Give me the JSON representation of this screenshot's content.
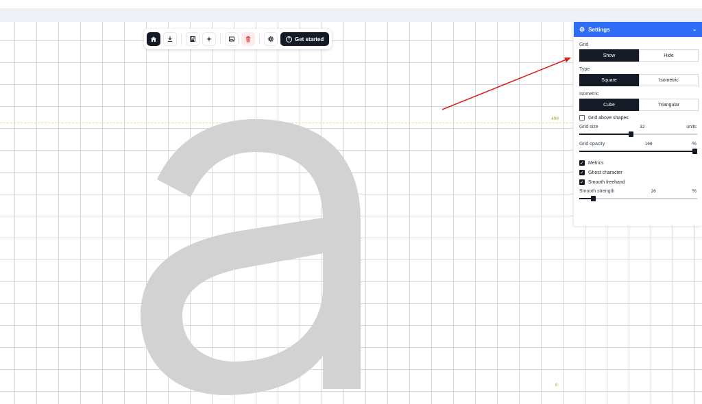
{
  "toolbar": {
    "buttons": [
      {
        "name": "home",
        "icon": "home-icon"
      },
      {
        "name": "download",
        "icon": "download-icon"
      },
      {
        "name": "save",
        "icon": "save-icon"
      },
      {
        "name": "sparkle",
        "icon": "sparkle-icon"
      },
      {
        "name": "image",
        "icon": "image-icon"
      },
      {
        "name": "delete",
        "icon": "trash-icon"
      },
      {
        "name": "settings",
        "icon": "gear-icon"
      }
    ],
    "get_started_label": "Get started",
    "accent": "#141a26",
    "danger": "#e53935"
  },
  "canvas": {
    "ghost_character": "a",
    "ascender_value": "490",
    "baseline_value": "0"
  },
  "settings": {
    "title": "Settings",
    "header_color": "#2f6df6",
    "grid": {
      "label": "Grid",
      "options": [
        "Show",
        "Hide"
      ],
      "selected": "Show"
    },
    "type": {
      "label": "Type",
      "options": [
        "Square",
        "Isometric"
      ],
      "selected": "Square"
    },
    "isometric": {
      "label": "Isometric",
      "options": [
        "Cube",
        "Triangular"
      ],
      "selected": "Cube"
    },
    "grid_above_shapes": {
      "label": "Grid above shapes",
      "checked": false
    },
    "grid_size": {
      "label": "Grid size",
      "value": "32",
      "unit": "units",
      "fraction": 0.44
    },
    "grid_opacity": {
      "label": "Grid opacity",
      "value": "100",
      "unit": "%",
      "fraction": 1.0
    },
    "metrics": {
      "label": "Metrics",
      "checked": true
    },
    "ghost_character": {
      "label": "Ghost character",
      "checked": true
    },
    "smooth_freehand": {
      "label": "Smooth freehand",
      "checked": true
    },
    "smooth_strength": {
      "label": "Smooth strength",
      "value": "20",
      "unit": "%",
      "fraction": 0.12
    }
  }
}
